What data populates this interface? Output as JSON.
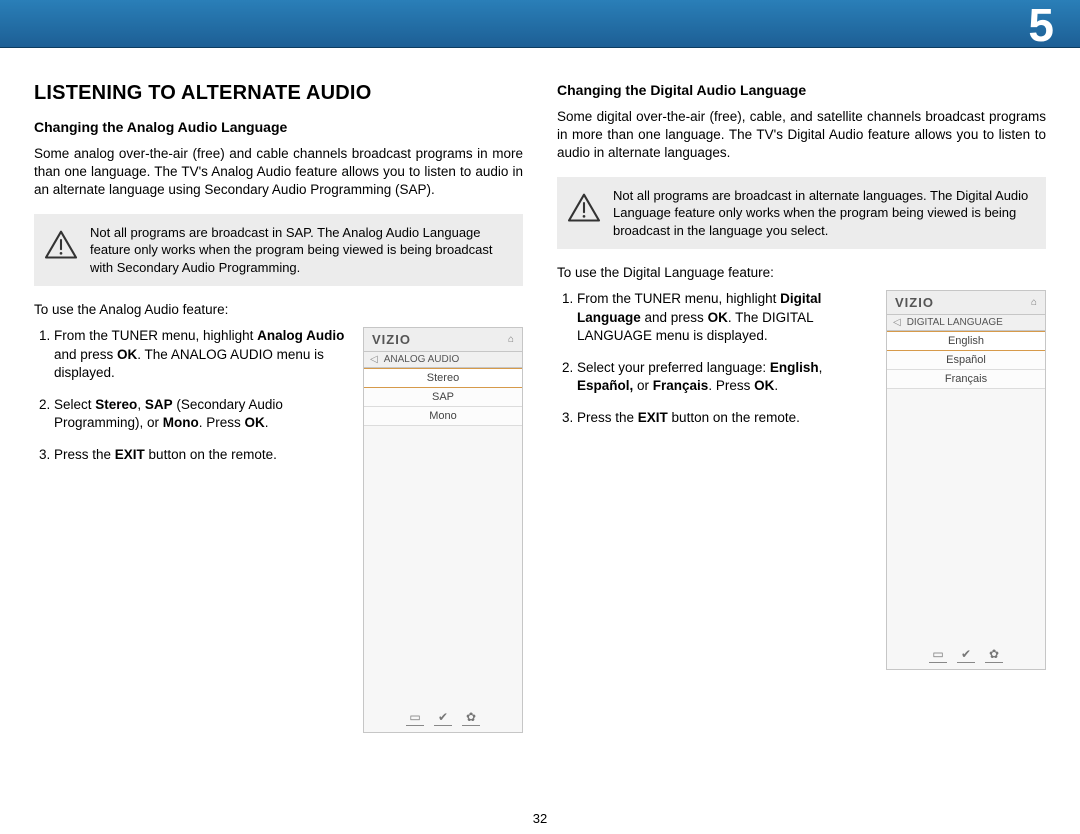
{
  "chapter_number": "5",
  "page_number": "32",
  "left": {
    "heading": "LISTENING TO ALTERNATE AUDIO",
    "subheading": "Changing the Analog Audio Language",
    "intro": "Some analog over-the-air (free) and cable channels broadcast programs in more than one language. The TV's Analog Audio feature allows you to listen to audio in an alternate language using Secondary Audio Programming (SAP).",
    "note": "Not all programs are broadcast in SAP. The Analog Audio Language feature only works when the program being viewed is being broadcast with Secondary Audio Programming.",
    "use_line": "To use the Analog Audio feature:",
    "steps_html": [
      "From the TUNER menu, highlight <b>Analog Audio</b> and press <b>OK</b>. The ANALOG AUDIO menu is displayed.",
      "Select <b>Stereo</b>, <b>SAP</b> (Secondary Audio Programming), or <b>Mono</b>. Press <b>OK</b>.",
      "Press the <b>EXIT</b> button on the remote."
    ],
    "menu": {
      "brand": "VIZIO",
      "title": "ANALOG AUDIO",
      "items": [
        "Stereo",
        "SAP",
        "Mono"
      ],
      "selected_index": 0
    }
  },
  "right": {
    "subheading": "Changing the Digital Audio Language",
    "intro": "Some digital over-the-air (free), cable, and satellite channels broadcast programs in more than one language. The TV's Digital Audio feature allows you to listen to audio in alternate languages.",
    "note": "Not all programs are broadcast in alternate languages. The Digital Audio Language feature only works when the program being viewed is being broadcast in the language you select.",
    "use_line": "To use the Digital Language feature:",
    "steps_html": [
      "From the TUNER menu, highlight <b>Digital Language</b> and press <b>OK</b>. The DIGITAL LANGUAGE menu is displayed.",
      "Select your preferred language: <b>English</b>, <b>Español,</b> or <b>Français</b>. Press <b>OK</b>.",
      "Press the <b>EXIT</b> button on the remote."
    ],
    "menu": {
      "brand": "VIZIO",
      "title": "DIGITAL LANGUAGE",
      "items": [
        "English",
        "Español",
        "Français"
      ],
      "selected_index": 0
    }
  }
}
